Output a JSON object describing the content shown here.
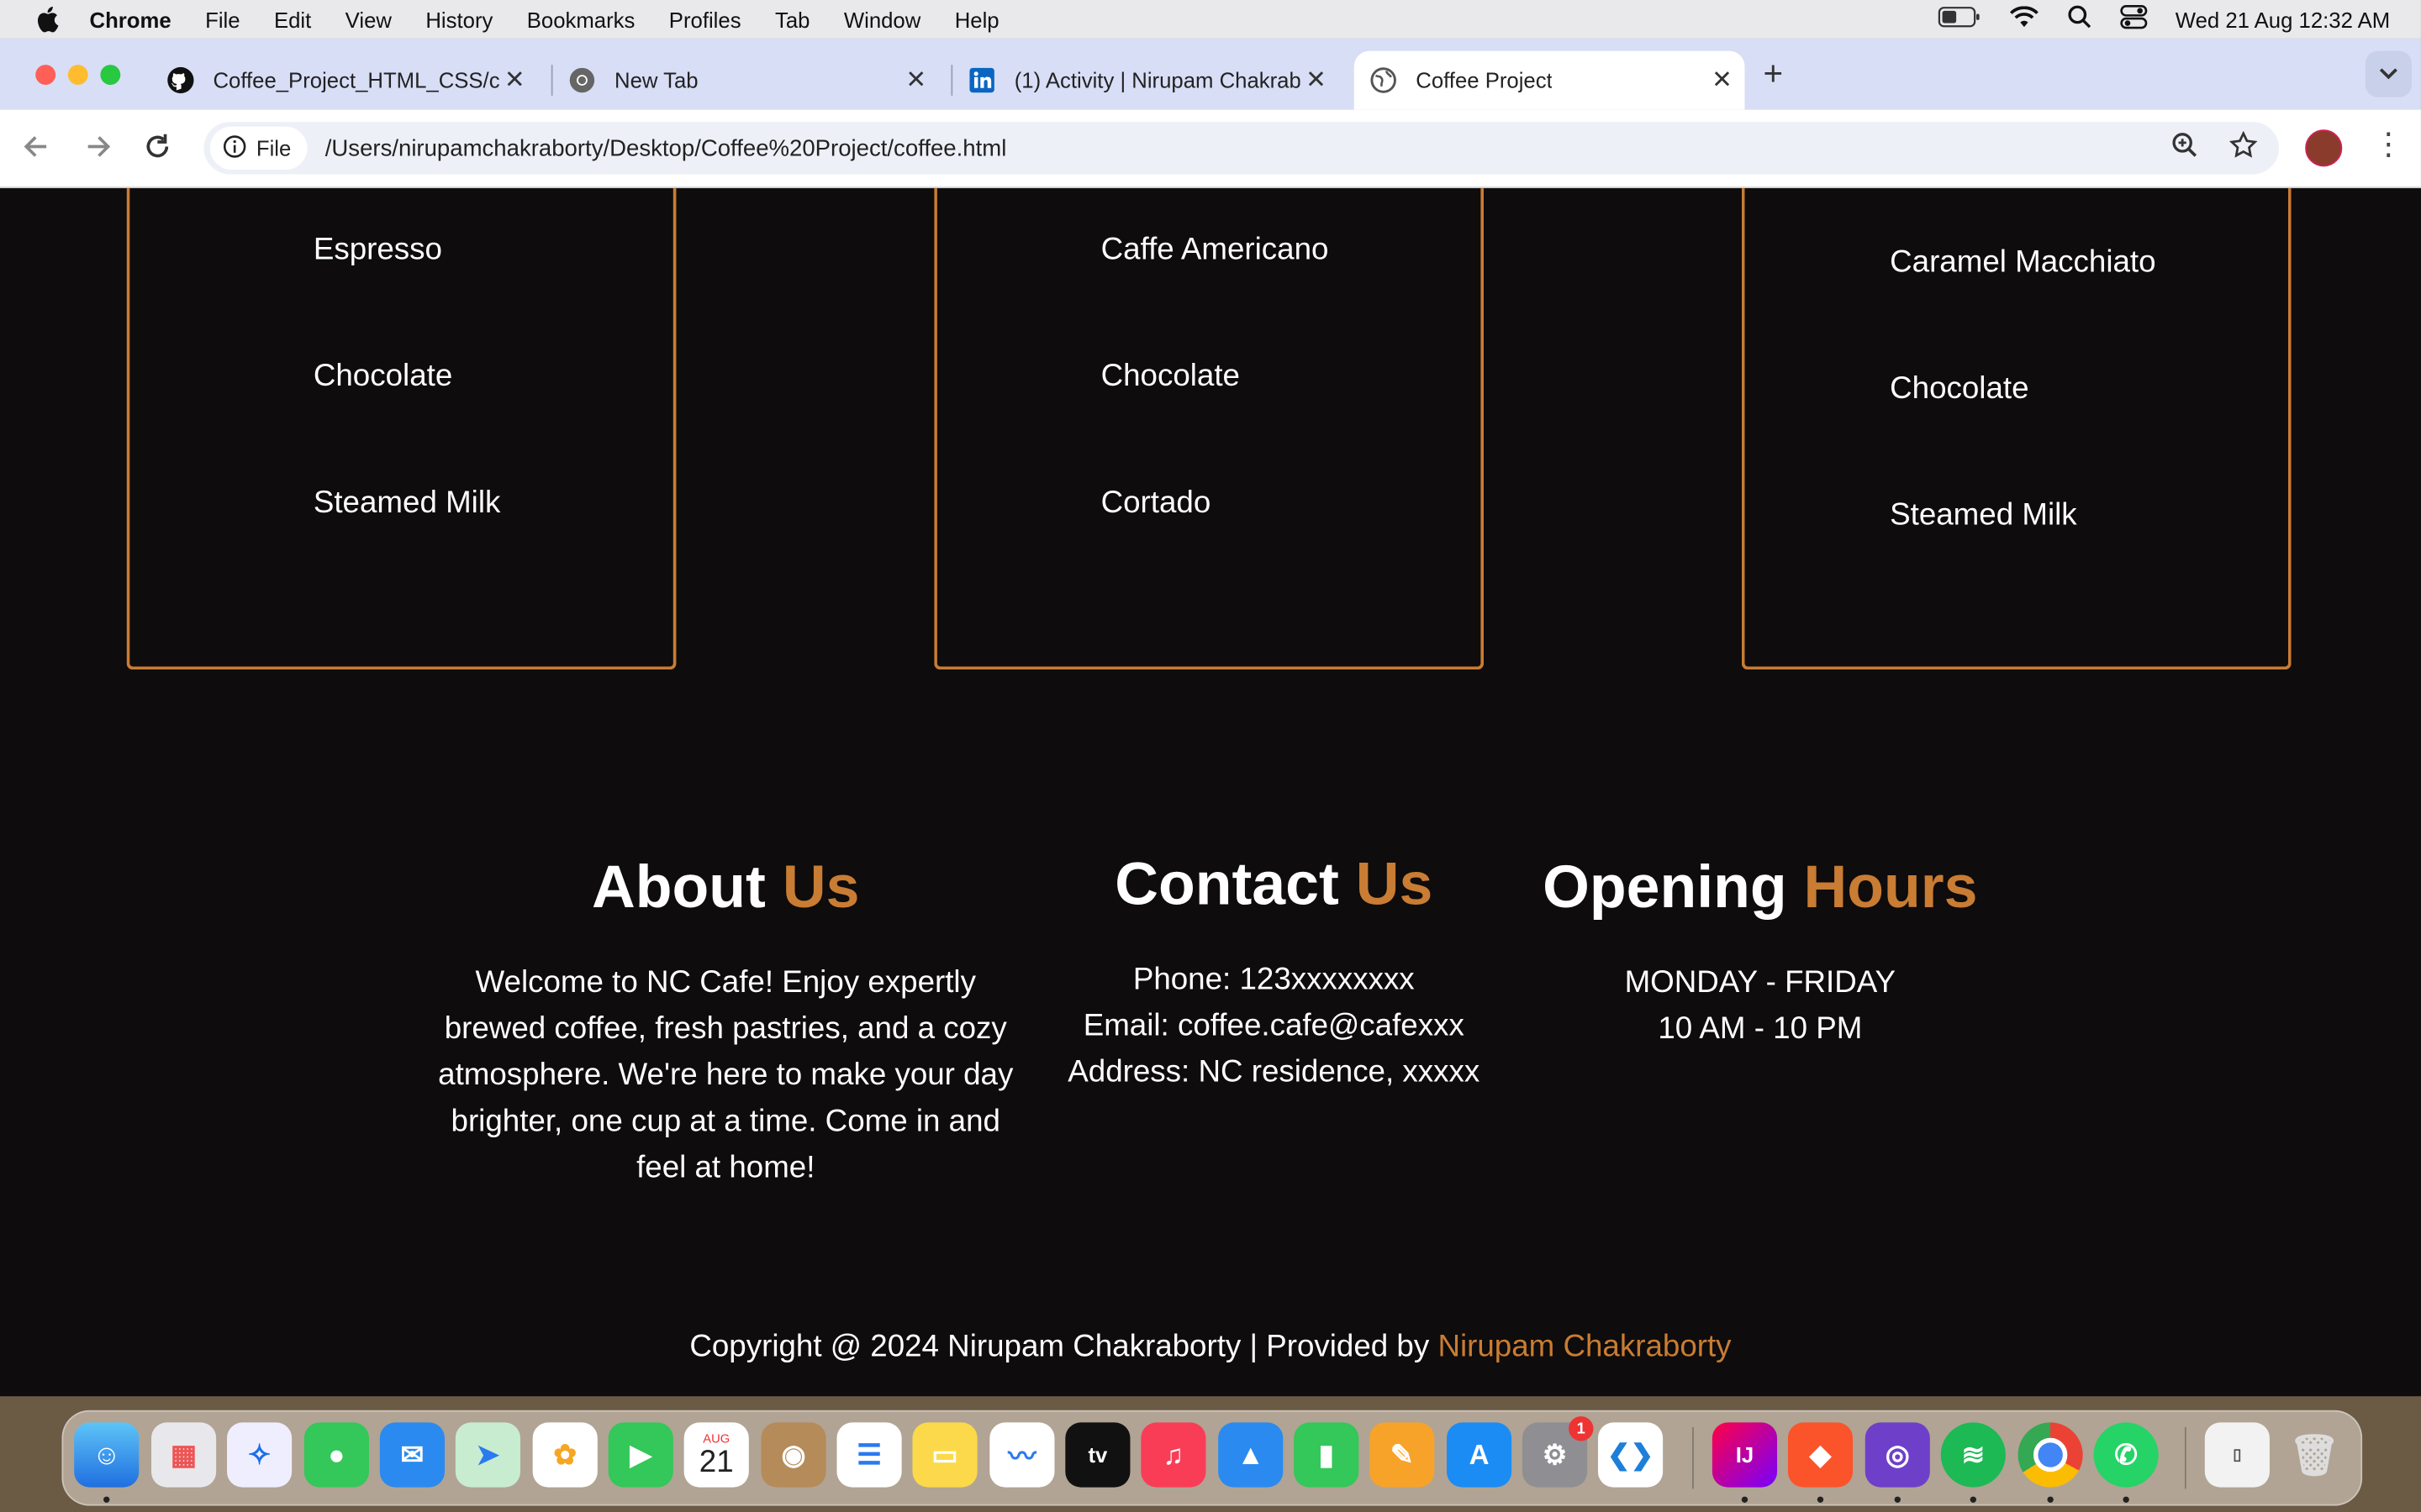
{
  "menubar": {
    "app": "Chrome",
    "items": [
      "File",
      "Edit",
      "View",
      "History",
      "Bookmarks",
      "Profiles",
      "Tab",
      "Window",
      "Help"
    ],
    "clock": "Wed 21 Aug  12:32 AM"
  },
  "browser": {
    "tabs": [
      {
        "title": "Coffee_Project_HTML_CSS/c",
        "icon": "github-icon"
      },
      {
        "title": "New Tab",
        "icon": "chrome-icon"
      },
      {
        "title": "(1) Activity | Nirupam Chakrab",
        "icon": "linkedin-icon"
      },
      {
        "title": "Coffee Project",
        "icon": "globe-icon",
        "active": true
      }
    ],
    "chip": "File",
    "url": "/Users/nirupamchakraborty/Desktop/Coffee%20Project/coffee.html"
  },
  "page": {
    "cards": [
      {
        "items": [
          "Espresso",
          "Chocolate",
          "Steamed Milk"
        ]
      },
      {
        "items": [
          "Caffe Americano",
          "Chocolate",
          "Cortado"
        ]
      },
      {
        "items": [
          "Caramel Macchiato",
          "Chocolate",
          "Steamed Milk"
        ]
      }
    ],
    "about": {
      "title_a": "About",
      "title_b": "Us",
      "lines": [
        "Welcome to NC Cafe! Enjoy expertly",
        "brewed coffee, fresh pastries, and a cozy",
        "atmosphere. We're here to make your day",
        "brighter, one cup at a time. Come in and",
        "feel at home!"
      ]
    },
    "contact": {
      "title_a": "Contact",
      "title_b": "Us",
      "phone": "Phone: 123xxxxxxxx",
      "email": "Email: coffee.cafe@cafexxx",
      "address": "Address: NC residence, xxxxx"
    },
    "hours": {
      "title_a": "Opening",
      "title_b": "Hours",
      "days": "MONDAY - FRIDAY",
      "time": "10 AM - 10 PM"
    },
    "copyright": "Copyright @ 2024 Nirupam Chakraborty | Provided by",
    "copyright_link": "Nirupam Chakraborty",
    "accent_color": "#c97c33"
  },
  "dock": {
    "calendar_month": "AUG",
    "calendar_day": "21",
    "settings_badge": "1",
    "apps": [
      "finder-icon",
      "launchpad-icon",
      "safari-icon",
      "messages-icon",
      "mail-icon",
      "maps-icon",
      "photos-icon",
      "facetime-icon",
      "calendar-icon",
      "contacts-icon",
      "reminders-icon",
      "notes-icon",
      "freeform-icon",
      "tv-icon",
      "music-icon",
      "keynote-icon",
      "numbers-icon",
      "pages-icon",
      "app-store-icon",
      "system-settings-icon",
      "vscode-icon",
      "intellij-icon",
      "brave-icon",
      "github-desktop-icon",
      "spotify-icon",
      "chrome-icon",
      "whatsapp-icon",
      "archive-icon",
      "trash-icon"
    ]
  }
}
